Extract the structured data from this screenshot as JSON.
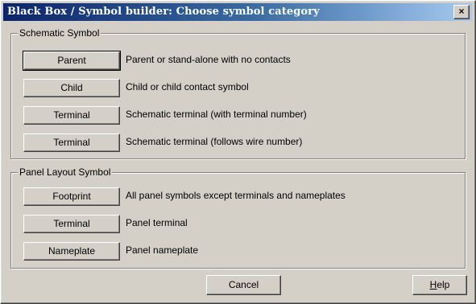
{
  "window": {
    "title": "Black Box / Symbol builder: Choose symbol category",
    "close_label": "×"
  },
  "schematic": {
    "label": "Schematic Symbol",
    "rows": [
      {
        "button": "Parent",
        "description": "Parent or stand-alone with no contacts"
      },
      {
        "button": "Child",
        "description": "Child or child contact symbol"
      },
      {
        "button": "Terminal",
        "description": "Schematic terminal (with terminal number)"
      },
      {
        "button": "Terminal",
        "description": "Schematic terminal (follows wire number)"
      }
    ]
  },
  "panel": {
    "label": "Panel Layout Symbol",
    "rows": [
      {
        "button": "Footprint",
        "description": "All panel symbols except terminals and nameplates"
      },
      {
        "button": "Terminal",
        "description": "Panel terminal"
      },
      {
        "button": "Nameplate",
        "description": "Panel nameplate"
      }
    ]
  },
  "footer": {
    "cancel_label": "Cancel",
    "help_first": "H",
    "help_rest": "elp"
  }
}
